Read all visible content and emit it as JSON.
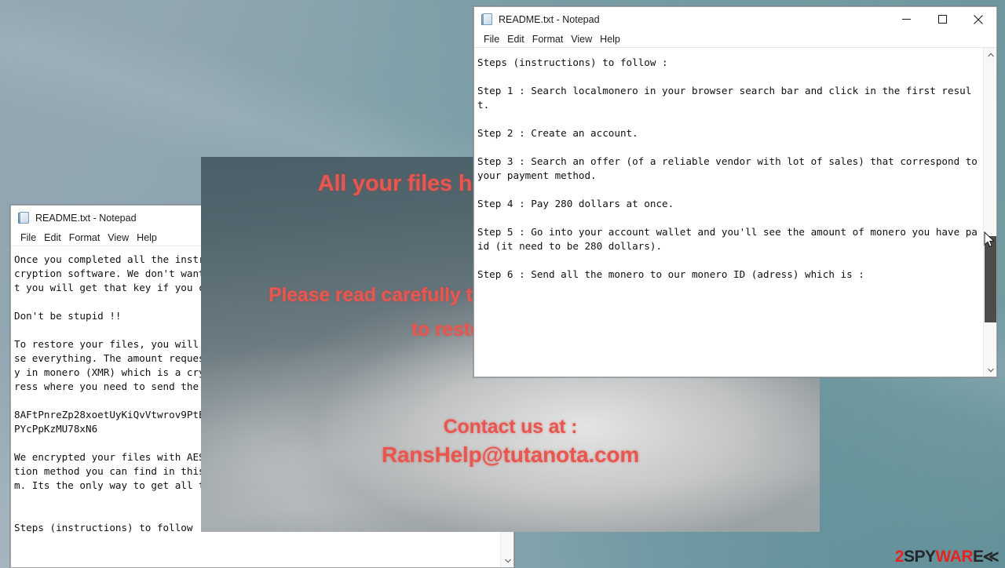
{
  "desktop": {
    "wallpaper_colors": [
      "#93a7b2",
      "#7fa0a8",
      "#5e8d97"
    ]
  },
  "ransom_overlay": {
    "headline": "All your files have been encrypted !!",
    "line2": "Please read carefully the README text file to be able",
    "line3": "to restore your files !!",
    "contact_label": "Contact us at :",
    "contact_email": "RansHelp@tutanota.com",
    "accent_color": "#e8574f"
  },
  "notepad_top": {
    "icon": "notepad-icon",
    "title": "README.txt - Notepad",
    "menu": [
      "File",
      "Edit",
      "Format",
      "View",
      "Help"
    ],
    "window_buttons": {
      "minimize": "minimize-button",
      "maximize": "maximize-button",
      "close": "close-button"
    },
    "content": "Steps (instructions) to follow :\n\nStep 1 : Search localmonero in your browser search bar and click in the first result.\n\nStep 2 : Create an account.\n\nStep 3 : Search an offer (of a reliable vendor with lot of sales) that correspond to your payment method.\n\nStep 4 : Pay 280 dollars at once.\n\nStep 5 : Go into your account wallet and you'll see the amount of monero you have paid (it need to be 280 dollars).\n\nStep 6 : Send all the monero to our monero ID (adress) which is :"
  },
  "notepad_bottom": {
    "icon": "notepad-icon",
    "title": "README.txt - Notepad",
    "menu": [
      "File",
      "Edit",
      "Format",
      "View",
      "Help"
    ],
    "window_buttons": {
      "minimize": "minimize-button",
      "maximize": "maximize-button"
    },
    "content": "Once you completed all the instructions below, we will be able to give you the decryption software. We don't want to loose time or play with you, we guarantee that you will get that key if you complete your job.\n\nDon't be stupid !!\n\nTo restore your files, you will need to pay a ransom within 62 hours you will loose everything. The amount requested is 280 dollars. An amount you will need to pay in monero (XMR) which is a cryptocurrency like bitcoin (BTC). Our monero ID (adress where you need to send the money) is :\n\n8AFtPnreZp28xoetUyKiQvVtwrov9PtEbMyvczdNZpBN45EUbEsrE8xYVp4NNqPrtxNjQwn3PbW3FG16EPYcPpKzMU78xN6\n\nWe encrypted your files with AES-256 encryption method. It's the strongest encryption method you can find in this world. Again, don't be stupid and pay the ransom. Its the only way to get all things to normal.\n\n\nSteps (instructions) to follow :"
  },
  "watermark": {
    "part1": "2",
    "part2": "SPY",
    "part3": "WAR",
    "part4": "E",
    "red": "#e8231f",
    "dark": "#24282b"
  }
}
